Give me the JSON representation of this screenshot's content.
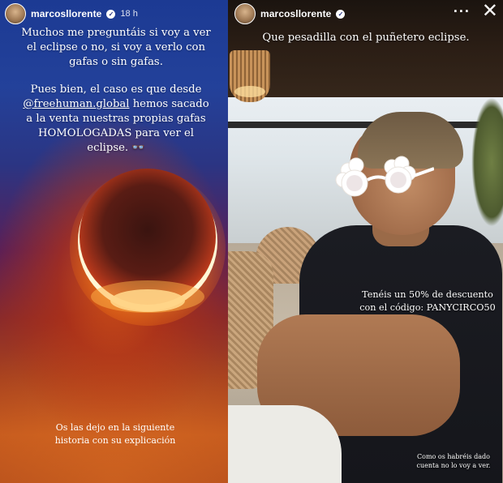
{
  "left_story": {
    "username": "marcosllorente",
    "timestamp": "18 h",
    "paragraph1": "Muchos me preguntáis si voy a ver el eclipse o no, si voy a verlo con gafas o sin gafas.",
    "paragraph2_before": "Pues bien, el caso es que desde ",
    "mention": "@freehuman.global",
    "paragraph2_after": " hemos sacado a la venta nuestras propias gafas HOMOLOGADAS para ver el eclipse. 👓",
    "bottom_text": "Os las dejo en la siguiente historia con su explicación"
  },
  "right_story": {
    "username": "marcosllorente",
    "title": "Que pesadilla con el puñetero eclipse.",
    "promo": "Tenéis un 50% de descuento con el código: PANYCIRCO50",
    "footer": "Como os habréis dado cuenta no lo voy a ver.",
    "more_icon": "more-dots-icon",
    "close_icon": "close-icon"
  }
}
